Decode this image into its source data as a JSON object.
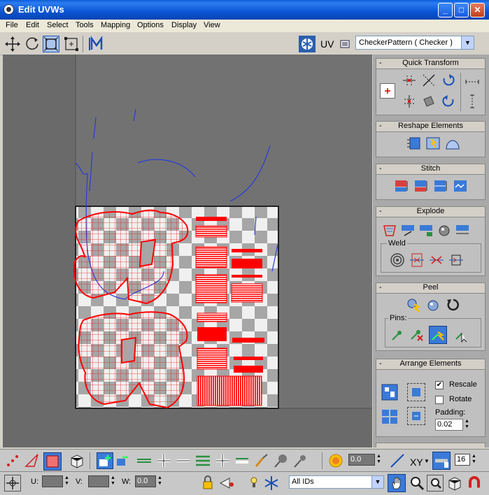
{
  "window": {
    "title": "Edit UVWs"
  },
  "menu": [
    "File",
    "Edit",
    "Select",
    "Tools",
    "Mapping",
    "Options",
    "Display",
    "View"
  ],
  "toolbar": {
    "uv_label": "UV",
    "map_select": "CheckerPattern  ( Checker )"
  },
  "panel": {
    "quick_transform": "Quick Transform",
    "reshape_elements": "Reshape Elements",
    "stitch": "Stitch",
    "explode": "Explode",
    "weld": "Weld",
    "peel": "Peel",
    "pins": "Pins:",
    "arrange_elements": "Arrange Elements",
    "rescale": "Rescale",
    "rotate": "Rotate",
    "padding_label": "Padding:",
    "padding_value": "0.02",
    "rescale_checked": true,
    "rotate_checked": false
  },
  "bottom": {
    "soft_value": "0.0",
    "xy_label": "XY",
    "grid_value": "16",
    "u_label": "U:",
    "v_label": "V:",
    "w_label": "W:",
    "w_value": "0.0",
    "ids_select": "All IDs"
  },
  "colors": {
    "accent": "#ff0000",
    "seam": "#2233cc",
    "titlebar": "#0b55d4"
  }
}
